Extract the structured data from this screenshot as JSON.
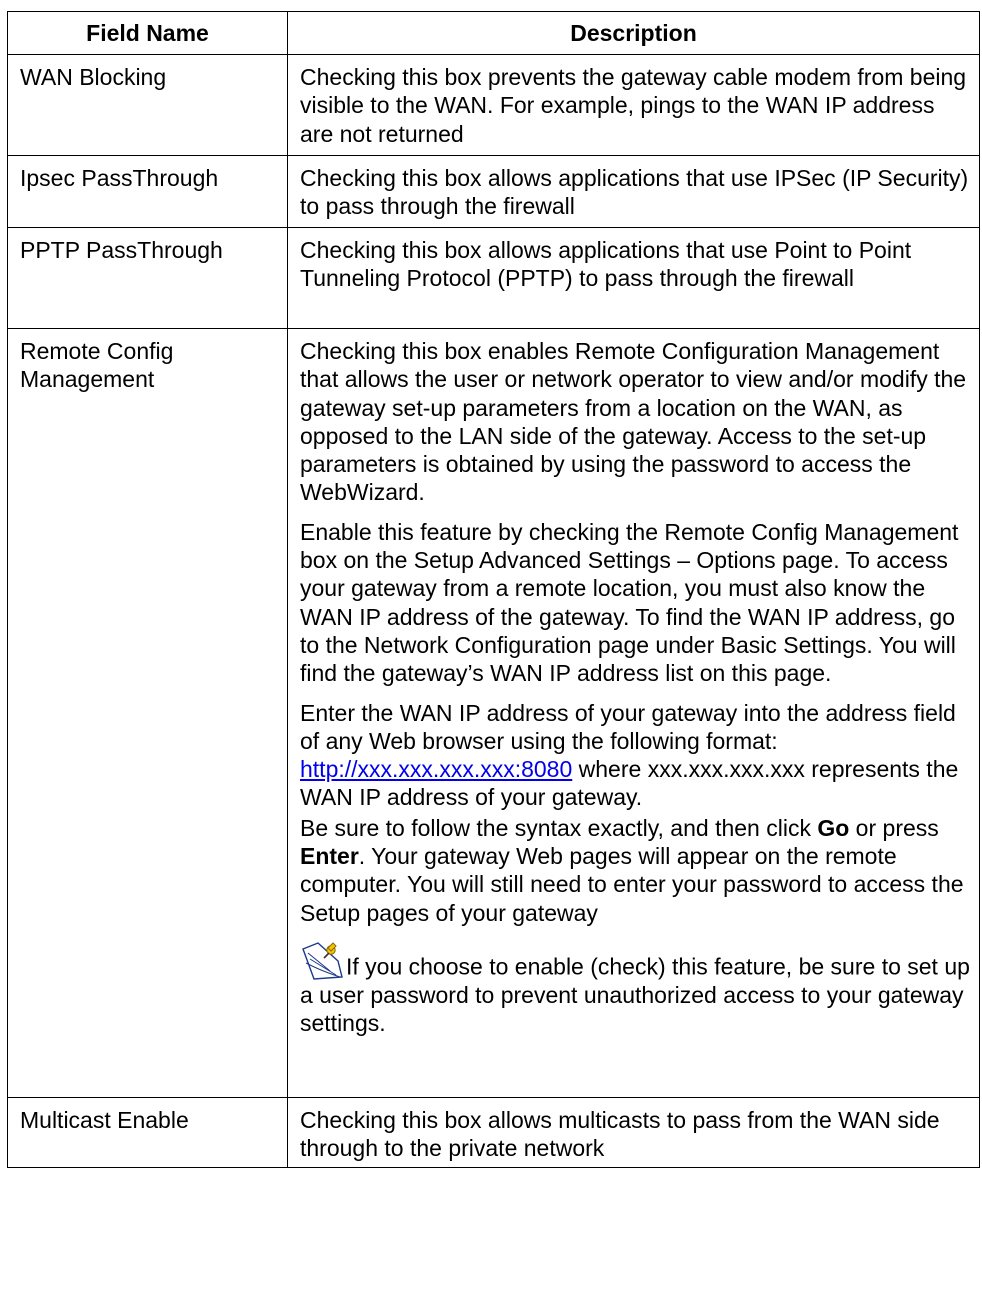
{
  "headers": {
    "field": "Field Name",
    "desc": "Description"
  },
  "rows": [
    {
      "name": "WAN Blocking",
      "desc": "Checking this box prevents the gateway cable modem from being visible to the WAN. For example, pings to the WAN IP address are not returned"
    },
    {
      "name": "Ipsec PassThrough",
      "desc": "Checking this box allows applications that use IPSec (IP Security) to pass through the firewall"
    },
    {
      "name": "PPTP PassThrough",
      "desc": "Checking this box allows applications that use Point to Point Tunneling Protocol (PPTP) to pass through the firewall"
    },
    {
      "name": "Remote Config Management",
      "p1": "Checking this box enables Remote Configuration Management that allows the user or network operator to view and/or modify the gateway set-up parameters from a location on the WAN, as opposed to the LAN side of the gateway. Access to the set-up parameters is obtained by using the password to access the WebWizard.",
      "p2": "Enable this feature by checking the Remote Config Management box on the Setup Advanced Settings – Options page. To access your gateway from a remote location, you must also know the WAN IP address of the gateway. To find the WAN IP address, go to the Network Configuration page under Basic Settings. You will find the gateway’s WAN IP address list on this page.",
      "p3_before": "Enter the WAN IP address of your gateway into the address field of any Web browser using the following format: ",
      "p3_link": "http://xxx.xxx.xxx.xxx:8080",
      "p3_after": " where xxx.xxx.xxx.xxx represents the WAN IP address of your gateway.",
      "p4_a": "Be sure to follow the syntax exactly, and then click ",
      "p4_go": "Go",
      "p4_b": " or press ",
      "p4_enter": "Enter",
      "p4_c": ". Your gateway Web pages will appear on the remote computer. You will still need to enter your password to access the Setup pages of your gateway",
      "note": "If you choose to enable (check) this feature, be sure to set up a user password to prevent unauthorized access to your gateway settings."
    },
    {
      "name": "Multicast Enable",
      "desc": "Checking this box allows multicasts to pass from the WAN side through to the private network"
    }
  ]
}
